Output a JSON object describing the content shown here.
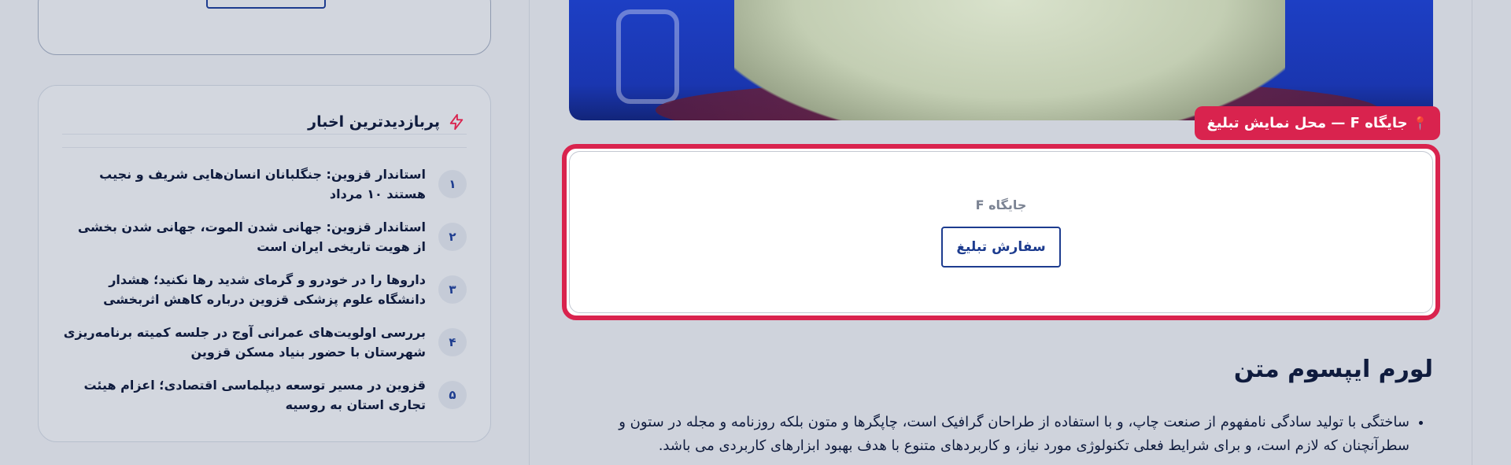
{
  "sidebar": {
    "popular": {
      "title": "پربازدیدترین اخبار",
      "icon": "bolt-icon",
      "items": [
        {
          "num": "۱",
          "text": "استاندار قزوین: جنگلبانان انسان‌هایی شریف و نجیب هستند ۱۰ مرداد"
        },
        {
          "num": "۲",
          "text": "استاندار قزوین: جهانی شدن الموت، جهانی شدن بخشی از هویت تاریخی ایران است"
        },
        {
          "num": "۳",
          "text": "داروها را در خودرو و گرمای شدید رها نکنید؛ هشدار دانشگاه علوم پزشکی قزوین درباره کاهش اثربخشی"
        },
        {
          "num": "۴",
          "text": "بررسی اولویت‌های عمرانی آوج در جلسه کمیته برنامه‌ریزی شهرستان با حضور بنیاد مسکن قزوین"
        },
        {
          "num": "۵",
          "text": "قزوین در مسیر توسعه دیپلماسی اقتصادی؛ اعزام هیئت تجاری استان به روسیه"
        }
      ]
    }
  },
  "ad": {
    "tag": "جایگاه F — محل نمایش تبلیغ",
    "tag_icon": "pin-icon",
    "placeholder": "جایگاه F",
    "order_button": "سفارش تبلیغ"
  },
  "article": {
    "title": "لورم ایپسوم متن",
    "paragraph": "ساختگی با تولید سادگی نامفهوم از صنعت چاپ، و با استفاده از طراحان گرافیک است، چاپگرها و متون بلکه روزنامه و مجله در ستون و سطرآنچنان که لازم است، و برای شرایط فعلی تکنولوژی مورد نیاز، و کاربردهای متنوع با هدف بهبود ابزارهای کاربردی می باشد."
  },
  "colors": {
    "accent": "#d9234e",
    "primary": "#1d3c8f",
    "background": "#cfd3dc"
  }
}
